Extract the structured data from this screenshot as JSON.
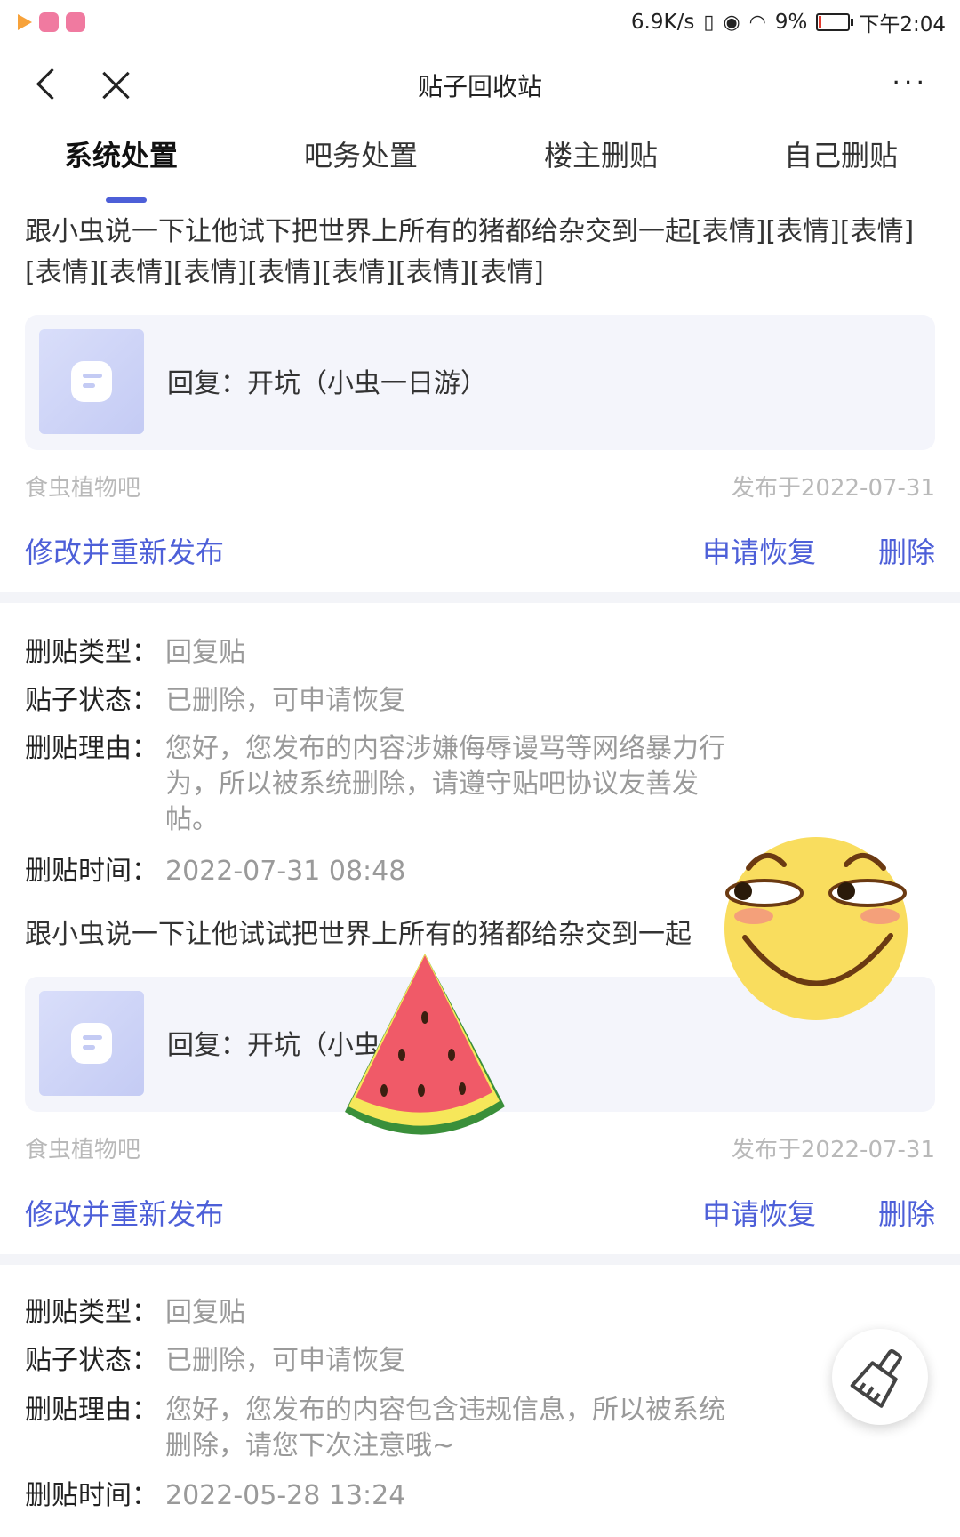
{
  "status_bar": {
    "speed": "6.9K/s",
    "battery": "9%",
    "time": "下午2:04"
  },
  "nav": {
    "title": "贴子回收站",
    "more": "···"
  },
  "tabs": [
    {
      "label": "系统处置",
      "active": true
    },
    {
      "label": "吧务处置",
      "active": false
    },
    {
      "label": "楼主删贴",
      "active": false
    },
    {
      "label": "自己删贴",
      "active": false
    }
  ],
  "labels": {
    "delete_type": "删贴类型：",
    "post_status": "贴子状态：",
    "delete_reason": "删贴理由：",
    "delete_time": "删贴时间：",
    "edit_repost": "修改并重新发布",
    "apply_restore": "申请恢复",
    "delete": "删除"
  },
  "posts": [
    {
      "text": "跟小虫说一下让他试下把世界上所有的猪都给杂交到一起[表情][表情][表情][表情][表情][表情][表情][表情][表情][表情]",
      "quote": "回复：开坑（小虫一日游）",
      "forum": "食虫植物吧",
      "date": "发布于2022-07-31"
    },
    {
      "delete_type": "回复贴",
      "status": "已删除，可申请恢复",
      "reason": "您好，您发布的内容涉嫌侮辱谩骂等网络暴力行为，所以被系统删除，请遵守贴吧协议友善发帖。",
      "time": "2022-07-31 08:48",
      "text": "跟小虫说一下让他试试把世界上所有的猪都给杂交到一起",
      "quote": "回复：开坑（小虫一日游）",
      "forum": "食虫植物吧",
      "date": "发布于2022-07-31"
    },
    {
      "delete_type": "回复贴",
      "status": "已删除，可申请恢复",
      "reason": "您好，您发布的内容包含违规信息，所以被系统删除，请您下次注意哦~",
      "time": "2022-05-28 13:24"
    }
  ],
  "icons": {
    "back": "back-arrow-icon",
    "close": "close-icon",
    "broom": "broom-icon"
  },
  "colors": {
    "accent": "#4d5fd8",
    "meta": "#b9b9b9"
  }
}
